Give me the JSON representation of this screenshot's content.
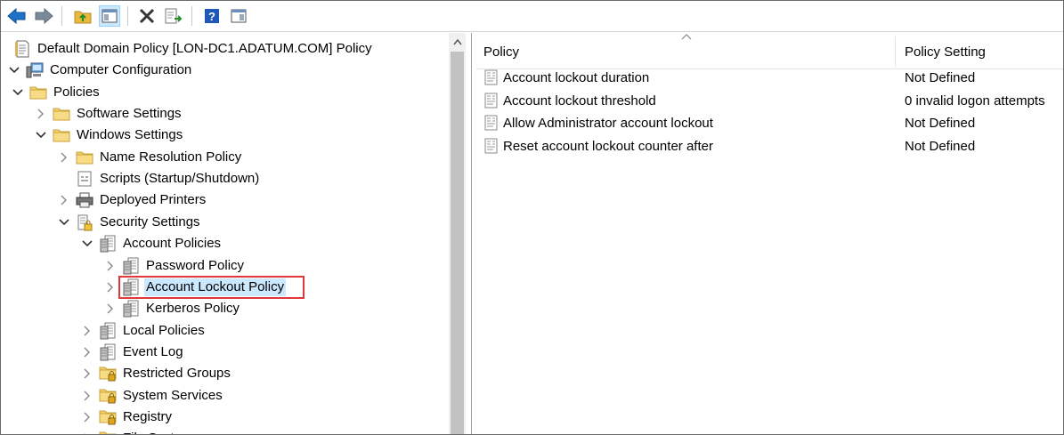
{
  "toolbar": {
    "buttons": [
      {
        "name": "back-button",
        "icon": "arrow-left-icon"
      },
      {
        "name": "forward-button",
        "icon": "arrow-right-icon"
      },
      {
        "name": "up-folder-button",
        "icon": "folder-up-icon"
      },
      {
        "name": "show-hide-console-tree-button",
        "icon": "console-tree-icon"
      },
      {
        "name": "delete-button",
        "icon": "delete-x-icon"
      },
      {
        "name": "export-list-button",
        "icon": "export-list-icon"
      },
      {
        "name": "help-button",
        "icon": "help-icon"
      },
      {
        "name": "show-hide-action-pane-button",
        "icon": "action-pane-icon"
      }
    ]
  },
  "tree": {
    "items": [
      {
        "label": "Default Domain Policy [LON-DC1.ADATUM.COM] Policy",
        "icon": "policy-document-icon",
        "level": 0,
        "expander": "none"
      },
      {
        "label": "Computer Configuration",
        "icon": "computer-icon",
        "level": 0,
        "expander": "expanded"
      },
      {
        "label": "Policies",
        "icon": "folder-icon",
        "level": 1,
        "expander": "expanded"
      },
      {
        "label": "Software Settings",
        "icon": "folder-icon",
        "level": 2,
        "expander": "collapsed"
      },
      {
        "label": "Windows Settings",
        "icon": "folder-icon",
        "level": 2,
        "expander": "expanded"
      },
      {
        "label": "Name Resolution Policy",
        "icon": "folder-icon",
        "level": 3,
        "expander": "collapsed"
      },
      {
        "label": "Scripts (Startup/Shutdown)",
        "icon": "script-icon",
        "level": 3,
        "expander": "none"
      },
      {
        "label": "Deployed Printers",
        "icon": "printer-icon",
        "level": 3,
        "expander": "collapsed"
      },
      {
        "label": "Security Settings",
        "icon": "security-settings-icon",
        "level": 3,
        "expander": "expanded"
      },
      {
        "label": "Account Policies",
        "icon": "policy-container-icon",
        "level": 4,
        "expander": "expanded"
      },
      {
        "label": "Password Policy",
        "icon": "policy-container-icon",
        "level": 5,
        "expander": "collapsed"
      },
      {
        "label": "Account Lockout Policy",
        "icon": "policy-container-icon",
        "level": 5,
        "expander": "collapsed",
        "selected": true
      },
      {
        "label": "Kerberos Policy",
        "icon": "policy-container-icon",
        "level": 5,
        "expander": "collapsed"
      },
      {
        "label": "Local Policies",
        "icon": "policy-container-icon",
        "level": 4,
        "expander": "collapsed"
      },
      {
        "label": "Event Log",
        "icon": "policy-container-icon",
        "level": 4,
        "expander": "collapsed"
      },
      {
        "label": "Restricted Groups",
        "icon": "locked-folder-icon",
        "level": 4,
        "expander": "collapsed"
      },
      {
        "label": "System Services",
        "icon": "locked-folder-icon",
        "level": 4,
        "expander": "collapsed"
      },
      {
        "label": "Registry",
        "icon": "locked-folder-icon",
        "level": 4,
        "expander": "collapsed"
      },
      {
        "label": "File System",
        "icon": "locked-folder-icon",
        "level": 4,
        "expander": "collapsed"
      }
    ]
  },
  "list": {
    "columns": {
      "policy": "Policy",
      "setting": "Policy Setting"
    },
    "rows": [
      {
        "policy": "Account lockout duration",
        "setting": "Not Defined"
      },
      {
        "policy": "Account lockout threshold",
        "setting": "0 invalid logon attempts"
      },
      {
        "policy": "Allow Administrator account lockout",
        "setting": "Not Defined"
      },
      {
        "policy": "Reset account lockout counter after",
        "setting": "Not Defined"
      }
    ]
  },
  "colors": {
    "selection": "#cce8ff",
    "highlight_border": "#e0373a",
    "folder": "#f5c542"
  }
}
